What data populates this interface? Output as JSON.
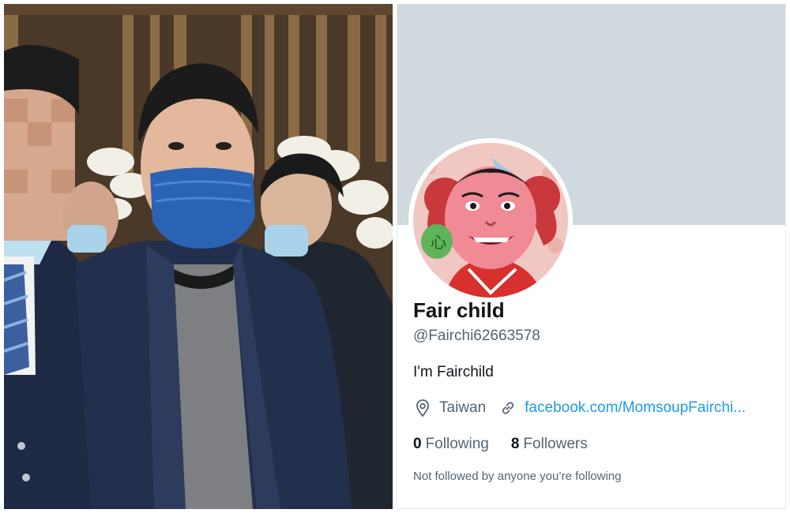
{
  "profile": {
    "display_name": "Fair child",
    "handle": "@Fairchi62663578",
    "bio": "I'm Fairchild",
    "location": "Taiwan",
    "website": "facebook.com/MomsoupFairchi...",
    "following_count": "0",
    "following_label": "Following",
    "followers_count": "8",
    "followers_label": "Followers",
    "followed_by_note": "Not followed by anyone you’re following"
  },
  "icons": {
    "location": "location-pin-icon",
    "link": "link-icon"
  },
  "colors": {
    "banner": "#cfd9de",
    "link": "#1d9bf0",
    "secondary_text": "#536471",
    "primary_text": "#0f1419"
  }
}
